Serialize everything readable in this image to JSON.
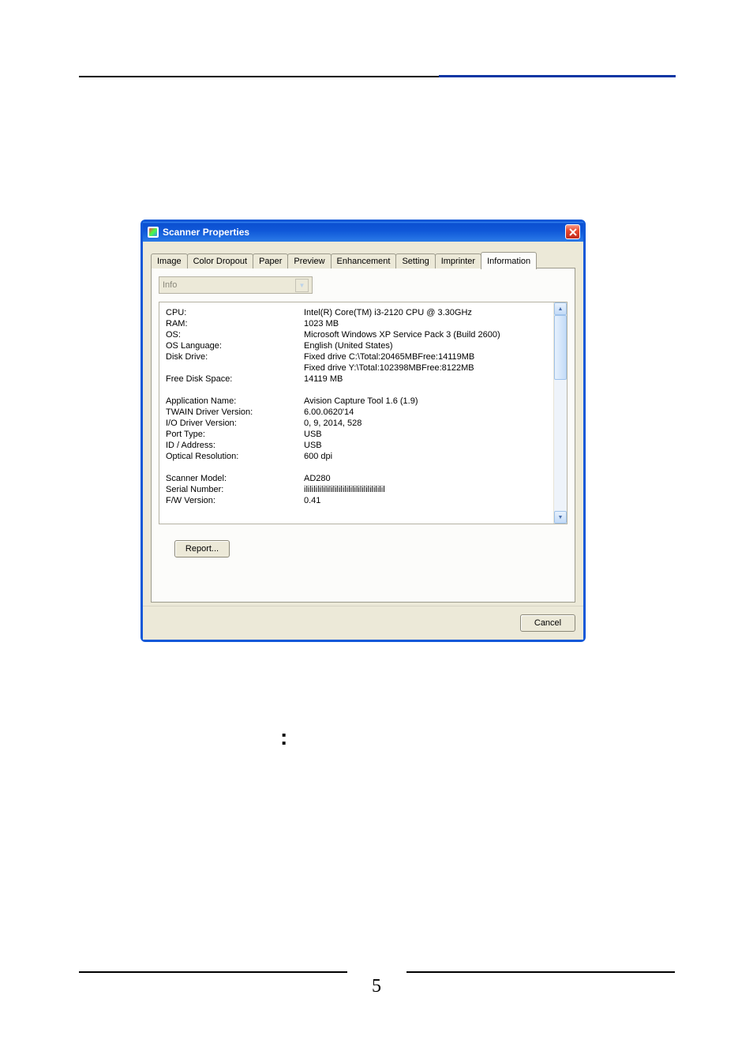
{
  "window": {
    "title": "Scanner Properties"
  },
  "tabs": [
    {
      "label": "Image"
    },
    {
      "label": "Color Dropout"
    },
    {
      "label": "Paper"
    },
    {
      "label": "Preview"
    },
    {
      "label": "Enhancement"
    },
    {
      "label": "Setting"
    },
    {
      "label": "Imprinter"
    },
    {
      "label": "Information"
    }
  ],
  "dropdown": {
    "value": "Info"
  },
  "info": [
    {
      "label": "CPU:",
      "value": "Intel(R) Core(TM) i3-2120 CPU @ 3.30GHz"
    },
    {
      "label": "RAM:",
      "value": "1023 MB"
    },
    {
      "label": "OS:",
      "value": "Microsoft Windows XP Service Pack 3 (Build 2600)"
    },
    {
      "label": "OS Language:",
      "value": "English (United States)"
    },
    {
      "label": "Disk Drive:",
      "value": "Fixed drive C:\\Total:20465MBFree:14119MB"
    },
    {
      "label": "",
      "value": "Fixed drive Y:\\Total:102398MBFree:8122MB"
    },
    {
      "label": "Free Disk Space:",
      "value": "14119 MB"
    }
  ],
  "info2": [
    {
      "label": "Application Name:",
      "value": "Avision Capture Tool 1.6 (1.9)"
    },
    {
      "label": "TWAIN Driver Version:",
      "value": "6.00.0620'14"
    },
    {
      "label": "I/O Driver Version:",
      "value": "0, 9, 2014, 528"
    },
    {
      "label": "Port Type:",
      "value": "USB"
    },
    {
      "label": "ID / Address:",
      "value": "USB"
    },
    {
      "label": "Optical Resolution:",
      "value": "600 dpi"
    }
  ],
  "info3": [
    {
      "label": "Scanner Model:",
      "value": "AD280"
    },
    {
      "label": "Serial Number:",
      "value": "ililililililililililililililililililililil"
    },
    {
      "label": "F/W Version:",
      "value": "0.41"
    }
  ],
  "buttons": {
    "report": "Report...",
    "cancel": "Cancel"
  },
  "page": {
    "colon": ":",
    "number": "5"
  }
}
